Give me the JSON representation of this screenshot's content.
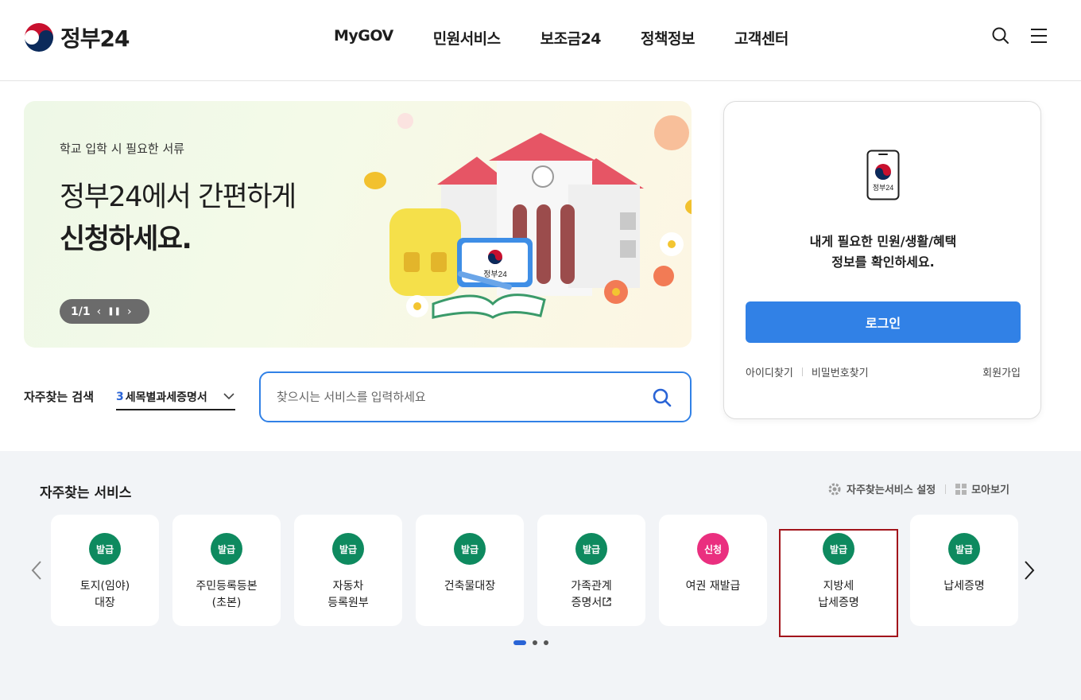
{
  "header": {
    "logo_text": "정부24",
    "nav": [
      "MyGOV",
      "민원서비스",
      "보조금24",
      "정책정보",
      "고객센터"
    ],
    "icons": [
      "search-icon",
      "menu-icon"
    ]
  },
  "banner": {
    "subtitle": "학교 입학 시 필요한 서류",
    "title_line1": "정부24에서 간편하게",
    "title_line2": "신청하세요.",
    "counter": "1/1",
    "art_sign": "정부24"
  },
  "search": {
    "label": "자주찾는 검색",
    "select_num": "3",
    "select_value": "세목별과세증명서",
    "placeholder": "찾으시는 서비스를 입력하세요"
  },
  "login": {
    "phone_label": "정부24",
    "message_line1": "내게 필요한 민원/생활/혜택",
    "message_line2": "정보를 확인하세요.",
    "button": "로그인",
    "find_id": "아이디찾기",
    "find_pw": "비밀번호찾기",
    "join": "회원가입"
  },
  "services": {
    "title": "자주찾는 서비스",
    "settings": "자주찾는서비스 설정",
    "view_all": "모아보기",
    "items": [
      {
        "badge": "발급",
        "line1": "토지(임야)",
        "line2": "대장",
        "color": "#0e8a5f"
      },
      {
        "badge": "발급",
        "line1": "주민등록등본",
        "line2": "(초본)",
        "color": "#0e8a5f"
      },
      {
        "badge": "발급",
        "line1": "자동차",
        "line2": "등록원부",
        "color": "#0e8a5f"
      },
      {
        "badge": "발급",
        "line1": "건축물대장",
        "line2": "",
        "color": "#0e8a5f"
      },
      {
        "badge": "발급",
        "line1": "가족관계",
        "line2": "증명서",
        "color": "#0e8a5f"
      },
      {
        "badge": "신청",
        "line1": "여권 재발급",
        "line2": "",
        "color": "#ea2f7f"
      },
      {
        "badge": "발급",
        "line1": "지방세",
        "line2": "납세증명",
        "color": "#0e8a5f"
      },
      {
        "badge": "발급",
        "line1": "납세증명",
        "line2": "",
        "color": "#0e8a5f"
      }
    ],
    "pagination": {
      "current": 1,
      "total": 3
    }
  }
}
